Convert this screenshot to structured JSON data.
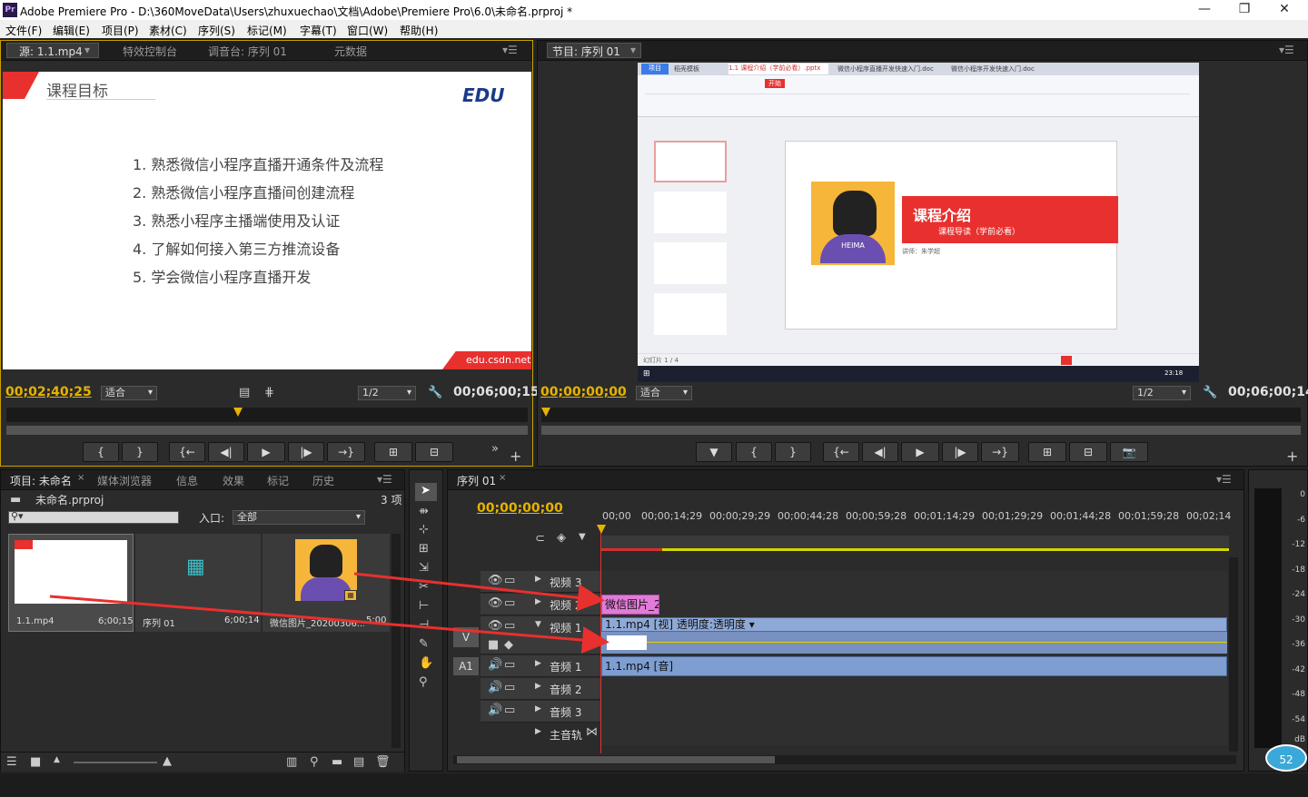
{
  "window": {
    "title": "Adobe Premiere Pro - D:\\360MoveData\\Users\\zhuxuechao\\文档\\Adobe\\Premiere Pro\\6.0\\未命名.prproj *",
    "logo": "Pr"
  },
  "menu": [
    "文件(F)",
    "编辑(E)",
    "项目(P)",
    "素材(C)",
    "序列(S)",
    "标记(M)",
    "字幕(T)",
    "窗口(W)",
    "帮助(H)"
  ],
  "source_monitor": {
    "tabs": [
      "源: 1.1.mp4",
      "特效控制台",
      "调音台: 序列 01",
      "元数据"
    ],
    "timecode": "00;02;40;25",
    "zoom": "适合",
    "resolution": "1/2",
    "duration": "00;06;00;15",
    "slide": {
      "heading": "课程目标",
      "logo": "EDU",
      "items": [
        "1.  熟悉微信小程序直播开通条件及流程",
        "2.  熟悉微信小程序直播间创建流程",
        "3.  熟悉小程序主播端使用及认证",
        "4.  了解如何接入第三方推流设备",
        "5.  学会微信小程序直播开发"
      ],
      "footer": "edu.csdn.net"
    },
    "buttons": [
      "{",
      "}",
      "{←",
      "◀|",
      "▶",
      "|▶",
      "→}"
    ]
  },
  "program_monitor": {
    "tab": "节目: 序列 01",
    "timecode": "00;00;00;00",
    "zoom": "适合",
    "resolution": "1/2",
    "duration": "00;06;00;14",
    "inner": {
      "tabs": [
        "项目",
        "稻壳模板",
        "1.1 课程介绍（学前必看）.pptx",
        "微信小程序直播开发快速入门.doc",
        "微信小程序开发快速入门.doc"
      ],
      "ribbon_tab": "开始",
      "slide_title": "课程介绍",
      "slide_sub": "课程导读（学前必看）",
      "slide_speaker": "讲师：朱学超",
      "mascot_label": "HEIMA",
      "status": "幻灯片 1 / 4",
      "taskbar_time": "23:18"
    },
    "buttons": [
      "▼",
      "{",
      "}",
      "{←",
      "◀|",
      "▶",
      "|▶",
      "→}"
    ]
  },
  "project_panel": {
    "tabs": [
      "项目: 未命名",
      "媒体浏览器",
      "信息",
      "效果",
      "标记",
      "历史"
    ],
    "project_name": "未命名.prproj",
    "count": "3 项",
    "in_label": "入口:",
    "in_value": "全部",
    "items": [
      {
        "name": "1.1.mp4",
        "duration": "6;00;15"
      },
      {
        "name": "序列 01",
        "duration": "6;00;14"
      },
      {
        "name": "微信图片_20200306...",
        "duration": "5;00"
      }
    ]
  },
  "timeline": {
    "tab": "序列 01",
    "timecode": "00;00;00;00",
    "ruler": [
      "00;00",
      "00;00;14;29",
      "00;00;29;29",
      "00;00;44;28",
      "00;00;59;28",
      "00;01;14;29",
      "00;01;29;29",
      "00;01;44;28",
      "00;01;59;28",
      "00;02;14"
    ],
    "tracks": {
      "v3": "视频 3",
      "v2": "视频 2",
      "v1": "视频 1",
      "a1": "音频 1",
      "a2": "音频 2",
      "a3": "音频 3",
      "master": "主音轨"
    },
    "target_v": "V",
    "target_a": "A1",
    "clips": {
      "image": "微信图片_2",
      "video": "1.1.mp4 [视] 透明度:透明度 ▾",
      "audio": "1.1.mp4 [音]"
    }
  },
  "meter": [
    "0",
    "-6",
    "-12",
    "-18",
    "-24",
    "-30",
    "-36",
    "-42",
    "-48",
    "-54",
    "dB"
  ],
  "badge": "52"
}
